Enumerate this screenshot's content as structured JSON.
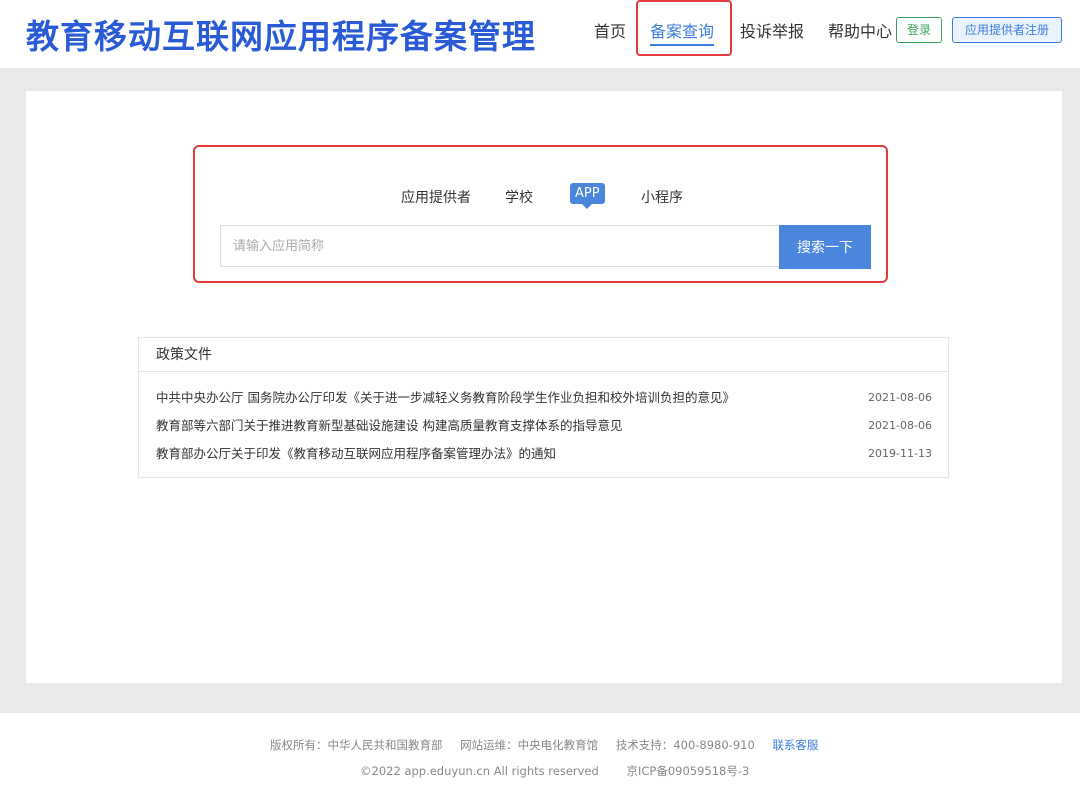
{
  "header": {
    "site_title": "教育移动互联网应用程序备案管理",
    "nav": {
      "home": "首页",
      "query": "备案查询",
      "complaint": "投诉举报",
      "help": "帮助中心"
    },
    "login_label": "登录",
    "register_label": "应用提供者注册"
  },
  "search": {
    "tabs": {
      "provider": "应用提供者",
      "school": "学校",
      "app": "APP",
      "mini": "小程序"
    },
    "active_tab": "APP",
    "input_placeholder": "请输入应用简称",
    "input_value": "",
    "button_label": "搜索一下"
  },
  "policy": {
    "header": "政策文件",
    "items": [
      {
        "title": "中共中央办公厅 国务院办公厅印发《关于进一步减轻义务教育阶段学生作业负担和校外培训负担的意见》",
        "date": "2021-08-06"
      },
      {
        "title": "教育部等六部门关于推进教育新型基础设施建设 构建高质量教育支撑体系的指导意见",
        "date": "2021-08-06"
      },
      {
        "title": "教育部办公厅关于印发《教育移动互联网应用程序备案管理办法》的通知",
        "date": "2019-11-13"
      }
    ]
  },
  "footer": {
    "copyright": "版权所有：中华人民共和国教育部",
    "operator": "网站运维：中央电化教育馆",
    "support": "技术支持：400-8980-910",
    "contact": "联系客服",
    "rights": "©2022 app.eduyun.cn All rights reserved",
    "icp": "京ICP备09059518号-3"
  },
  "colors": {
    "brand": "#2a5bd7",
    "accent": "#4a86dc",
    "highlight_border": "#e03a3a",
    "login_green": "#3aa35a"
  }
}
